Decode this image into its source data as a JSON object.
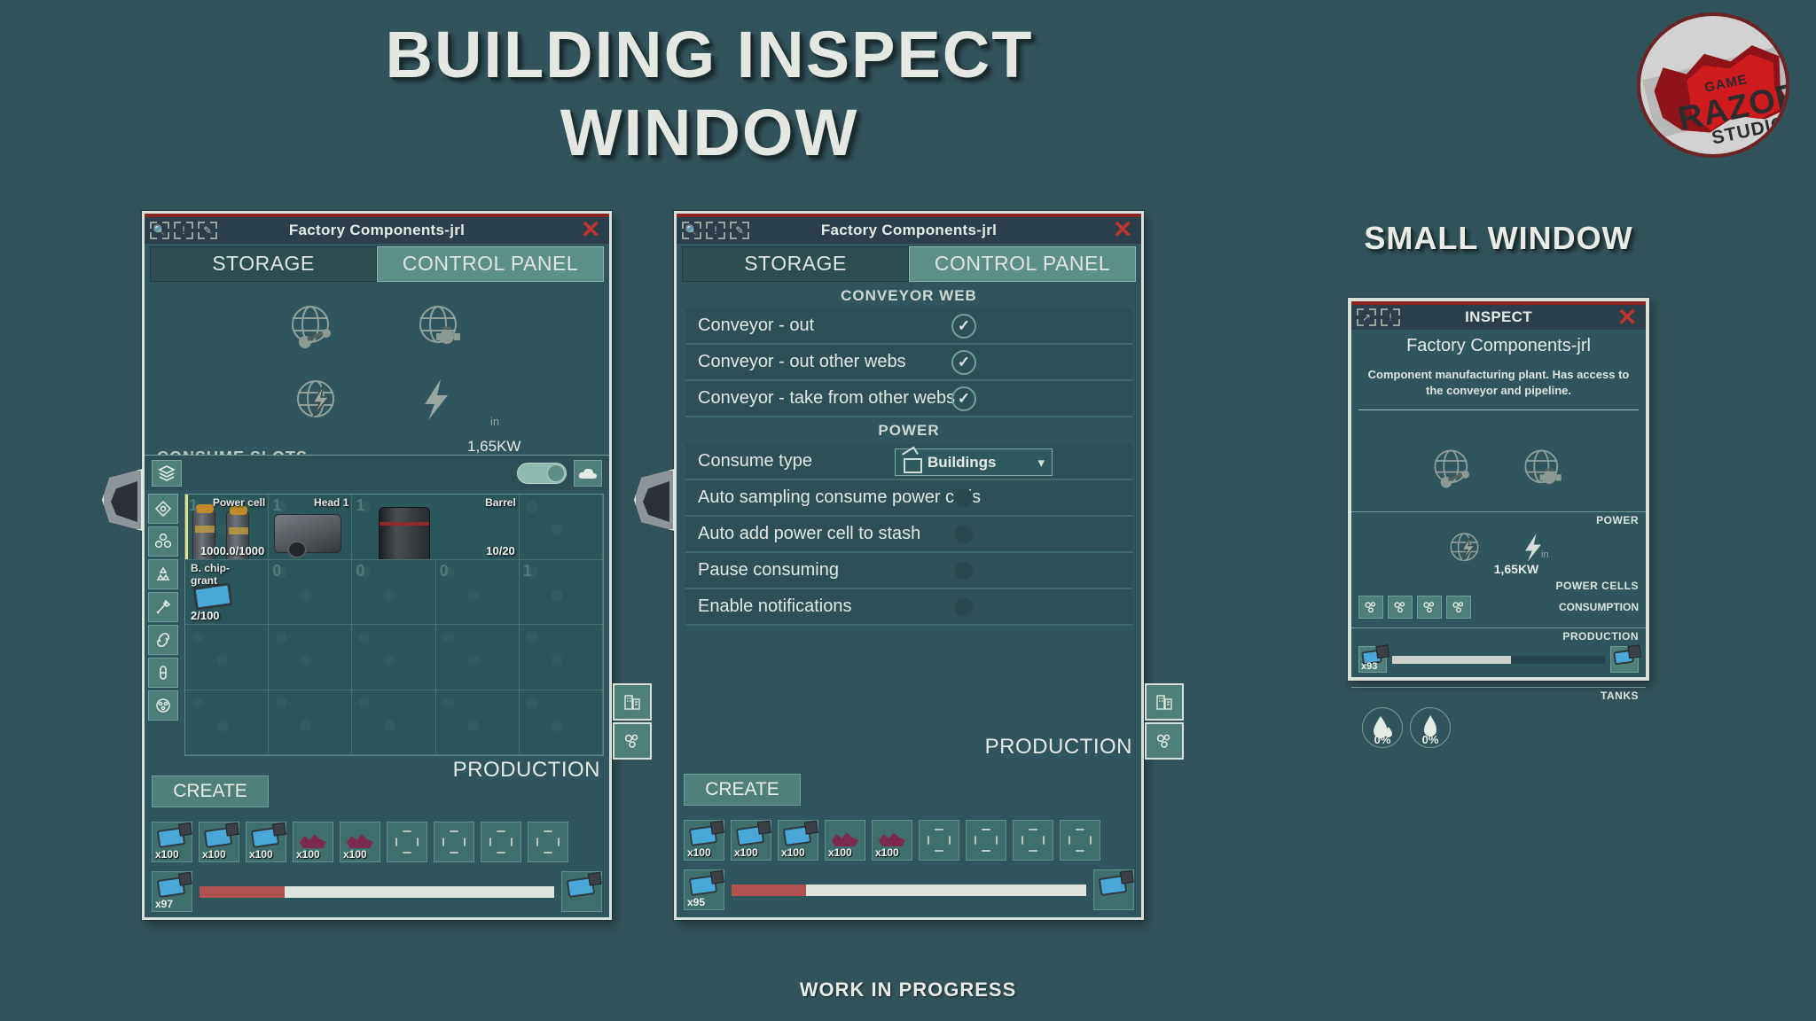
{
  "page": {
    "title_line1": "BUILDING INSPECT",
    "title_line2": "WINDOW",
    "small_window_title": "SMALL WINDOW",
    "footer": "WORK IN PROGRESS",
    "bg_color": "#31545a"
  },
  "logo": {
    "line1": "GAME",
    "line2": "RAZOR",
    "line3": "STUDIO"
  },
  "window1": {
    "title": "Factory Components-jrl",
    "close": "✕",
    "tabs": [
      {
        "label": "STORAGE",
        "active": false
      },
      {
        "label": "CONTROL PANEL",
        "active": true
      }
    ],
    "power": {
      "in_suffix": "in",
      "value": "1,65KW"
    },
    "consume_slots_label": "CONSUME SLOTS",
    "inventory": [
      {
        "name": "Power cell",
        "count": "1000.0/1000",
        "qty_bg": "1",
        "art": "powercell",
        "selected": true
      },
      {
        "name": "Head 1",
        "count": "",
        "qty_bg": "1",
        "art": "head",
        "selected": false
      },
      {
        "name": "Barrel",
        "count": "10/20",
        "qty_bg": "1",
        "art": "barrel",
        "selected": false
      },
      {
        "name": "B. chip-grant",
        "count": "2/100",
        "qty_bg": "",
        "art": "chip",
        "selected": false
      },
      {
        "name": "",
        "count": "",
        "qty_bg": "0",
        "art": "",
        "selected": false
      },
      {
        "name": "",
        "count": "",
        "qty_bg": "0",
        "art": "",
        "selected": false
      },
      {
        "name": "",
        "count": "",
        "qty_bg": "0",
        "art": "",
        "selected": false
      },
      {
        "name": "",
        "count": "",
        "qty_bg": "1",
        "art": "",
        "selected": false
      }
    ],
    "production": {
      "label": "PRODUCTION",
      "create_button": "CREATE",
      "recipe": [
        {
          "art": "gun",
          "count": "x100"
        },
        {
          "art": "gun",
          "count": "x100"
        },
        {
          "art": "gun",
          "count": "x100"
        },
        {
          "art": "ore",
          "count": "x100"
        },
        {
          "art": "ore",
          "count": "x100"
        },
        {
          "art": "empty",
          "count": ""
        },
        {
          "art": "empty",
          "count": ""
        },
        {
          "art": "empty",
          "count": ""
        },
        {
          "art": "empty",
          "count": ""
        }
      ],
      "output_count": "x97",
      "progress_percent": 24
    }
  },
  "window2": {
    "title": "Factory Components-jrl",
    "close": "✕",
    "tabs": [
      {
        "label": "STORAGE",
        "active": false
      },
      {
        "label": "CONTROL PANEL",
        "active": true
      }
    ],
    "sections": [
      {
        "header": "CONVEYOR WEB",
        "rows": [
          {
            "label": "Conveyor - out",
            "control": "check",
            "value": "✓"
          },
          {
            "label": "Conveyor - out other webs",
            "control": "check",
            "value": "✓"
          },
          {
            "label": "Conveyor - take from other webs",
            "control": "check",
            "value": "✓"
          }
        ]
      },
      {
        "header": "POWER",
        "rows": [
          {
            "label": "Consume type",
            "control": "dropdown",
            "value": "Buildings"
          },
          {
            "label": "Auto sampling consume power cells",
            "control": "dot",
            "value": ""
          },
          {
            "label": "Auto add power cell to stash",
            "control": "dot",
            "value": ""
          },
          {
            "label": "Pause consuming",
            "control": "dot",
            "value": ""
          },
          {
            "label": "Enable notifications",
            "control": "dot",
            "value": ""
          }
        ]
      }
    ],
    "production": {
      "label": "PRODUCTION",
      "create_button": "CREATE",
      "recipe": [
        {
          "art": "gun",
          "count": "x100"
        },
        {
          "art": "gun",
          "count": "x100"
        },
        {
          "art": "gun",
          "count": "x100"
        },
        {
          "art": "ore",
          "count": "x100"
        },
        {
          "art": "ore",
          "count": "x100"
        },
        {
          "art": "empty",
          "count": ""
        },
        {
          "art": "empty",
          "count": ""
        },
        {
          "art": "empty",
          "count": ""
        },
        {
          "art": "empty",
          "count": ""
        }
      ],
      "output_count": "x95",
      "progress_percent": 21
    }
  },
  "window3": {
    "title": "INSPECT",
    "close": "✕",
    "building_name": "Factory Components-jrl",
    "description": "Component manufacturing plant. Has access to the conveyor and pipeline.",
    "power_label": "POWER",
    "power_value": "1,65KW",
    "power_in_suffix": "in",
    "power_cells_label": "POWER CELLS",
    "consumption_label": "CONSUMPTION",
    "cell_count": 4,
    "production_label": "PRODUCTION",
    "production_count": "x93",
    "production_percent": 56,
    "tanks_label": "TANKS",
    "tanks": [
      {
        "type": "water",
        "value": "0%"
      },
      {
        "type": "fuel",
        "value": "0%"
      }
    ]
  }
}
